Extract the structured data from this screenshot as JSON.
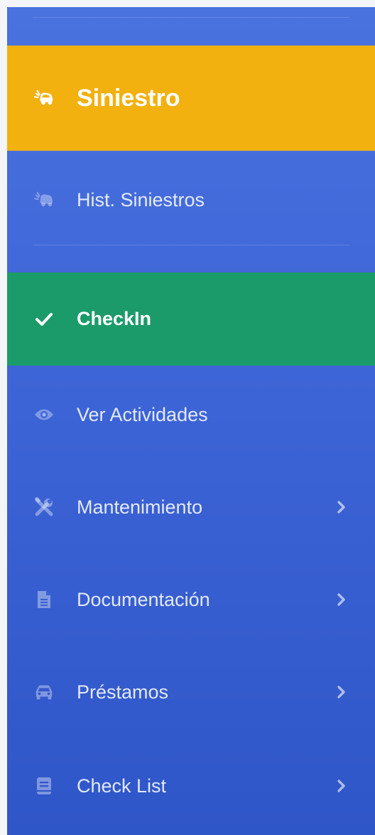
{
  "sidebar": {
    "colors": {
      "background_top": "#4a72de",
      "background_bottom": "#2f56c8",
      "active_warning": "#f3b10f",
      "active_success": "#1b9b69"
    },
    "items": [
      {
        "label": "Siniestro",
        "icon": "car-crash-icon",
        "state": "highlighted-warning",
        "has_submenu": false
      },
      {
        "label": "Hist. Siniestros",
        "icon": "car-crash-icon",
        "state": "normal",
        "has_submenu": false
      },
      {
        "label": "CheckIn",
        "icon": "check-icon",
        "state": "highlighted-success",
        "has_submenu": false
      },
      {
        "label": "Ver Actividades",
        "icon": "eye-icon",
        "state": "normal",
        "has_submenu": false
      },
      {
        "label": "Mantenimiento",
        "icon": "tools-icon",
        "state": "normal",
        "has_submenu": true
      },
      {
        "label": "Documentación",
        "icon": "file-icon",
        "state": "normal",
        "has_submenu": true
      },
      {
        "label": "Préstamos",
        "icon": "car-icon",
        "state": "normal",
        "has_submenu": true
      },
      {
        "label": "Check List",
        "icon": "book-icon",
        "state": "normal",
        "has_submenu": true
      }
    ]
  }
}
